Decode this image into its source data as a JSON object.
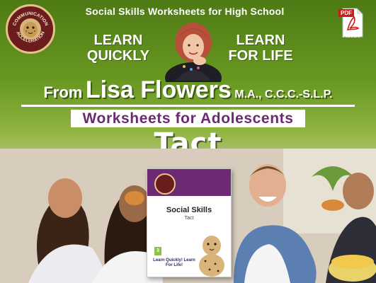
{
  "header": {
    "title": "Social Skills Worksheets for High School",
    "seal_text": "COMMUNICATION ACCELERATION",
    "pdf_tag": "PDF",
    "pdf_label": "Adobe"
  },
  "slogans": {
    "left": [
      "LEARN",
      "QUICKLY"
    ],
    "right": [
      "LEARN",
      "FOR LIFE"
    ]
  },
  "author": {
    "prefix": "From",
    "name": "Lisa Flowers",
    "credentials": "M.A., C.C.C.-S.L.P."
  },
  "subtitle": "Worksheets for Adolescents",
  "main_title": "Tact",
  "book": {
    "title": "Social Skills",
    "subtitle": "Tact",
    "grade": "3",
    "slogan": "Learn Quickly! Learn For Life!"
  },
  "colors": {
    "green_dark": "#4d7a14",
    "purple": "#6b2a72",
    "seal_red": "#6b1d1d",
    "gold": "#e6c28a",
    "pdf_red": "#d11b1b"
  }
}
